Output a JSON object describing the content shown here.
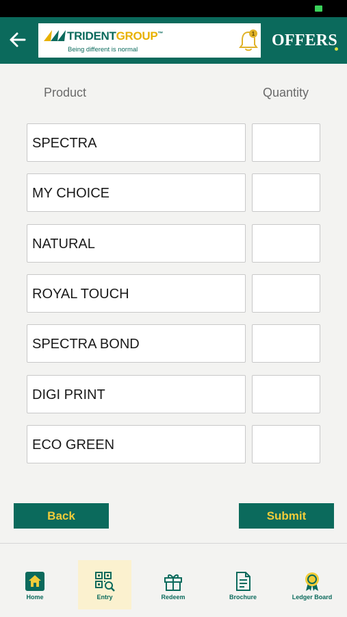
{
  "header": {
    "logo_name": "TRIDENT",
    "logo_group": "GROUP",
    "logo_tm": "™",
    "logo_tagline": "Being different is normal",
    "notification_count": "1",
    "offers_label": "OFFERS"
  },
  "table": {
    "product_header": "Product",
    "quantity_header": "Quantity",
    "rows": [
      {
        "product": "SPECTRA",
        "quantity": ""
      },
      {
        "product": "MY CHOICE",
        "quantity": ""
      },
      {
        "product": "NATURAL",
        "quantity": ""
      },
      {
        "product": "ROYAL TOUCH",
        "quantity": ""
      },
      {
        "product": "SPECTRA BOND",
        "quantity": ""
      },
      {
        "product": "DIGI PRINT",
        "quantity": ""
      },
      {
        "product": "ECO GREEN",
        "quantity": ""
      }
    ]
  },
  "actions": {
    "back_label": "Back",
    "submit_label": "Submit"
  },
  "tabbar": {
    "items": [
      {
        "label": "Home",
        "icon": "home-icon"
      },
      {
        "label": "Entry",
        "icon": "qr-scan-icon",
        "active": true
      },
      {
        "label": "Redeem",
        "icon": "gift-icon"
      },
      {
        "label": "Brochure",
        "icon": "document-icon"
      },
      {
        "label": "Ledger Board",
        "icon": "award-icon"
      }
    ]
  },
  "colors": {
    "brand_green": "#0b6a5c",
    "accent_yellow": "#f1cc3a",
    "active_tab_bg": "#fbf1cf"
  }
}
